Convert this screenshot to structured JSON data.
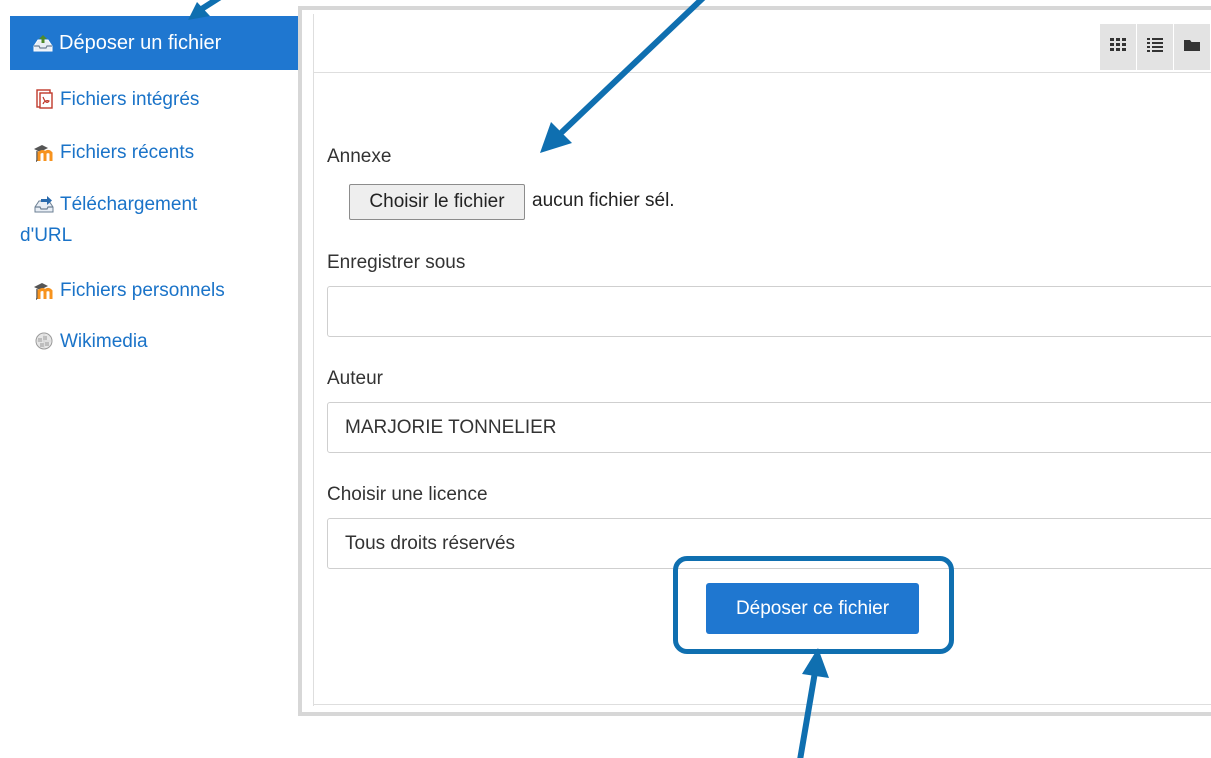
{
  "sidebar": {
    "active_item": {
      "label": "Déposer un fichier",
      "icon": "upload-tray-icon"
    },
    "items": [
      {
        "label": "Fichiers intégrés",
        "icon": "pdf-document-icon"
      },
      {
        "label": "Fichiers récents",
        "icon": "moodle-logo-icon"
      },
      {
        "label_line1": "Téléchargement",
        "label_line2": "d'URL",
        "icon": "url-download-icon"
      },
      {
        "label": "Fichiers personnels",
        "icon": "moodle-logo-icon"
      },
      {
        "label": "Wikimedia",
        "icon": "wikipedia-globe-icon"
      }
    ]
  },
  "toolbar": {
    "view_buttons": [
      {
        "icon": "grid-view-icon"
      },
      {
        "icon": "list-view-icon"
      },
      {
        "icon": "folder-view-icon"
      }
    ]
  },
  "form": {
    "attachment_label": "Annexe",
    "choose_file_button": "Choisir le fichier",
    "file_status": "aucun fichier sél.",
    "save_as_label": "Enregistrer sous",
    "save_as_value": "",
    "author_label": "Auteur",
    "author_value": "MARJORIE TONNELIER",
    "license_label": "Choisir une licence",
    "license_value": "Tous droits réservés",
    "submit_button": "Déposer ce fichier"
  },
  "colors": {
    "accent_blue": "#1f77d0",
    "link_blue": "#1a73c8",
    "annotation_blue": "#0f6fb0",
    "panel_border": "#d7d7d7"
  }
}
